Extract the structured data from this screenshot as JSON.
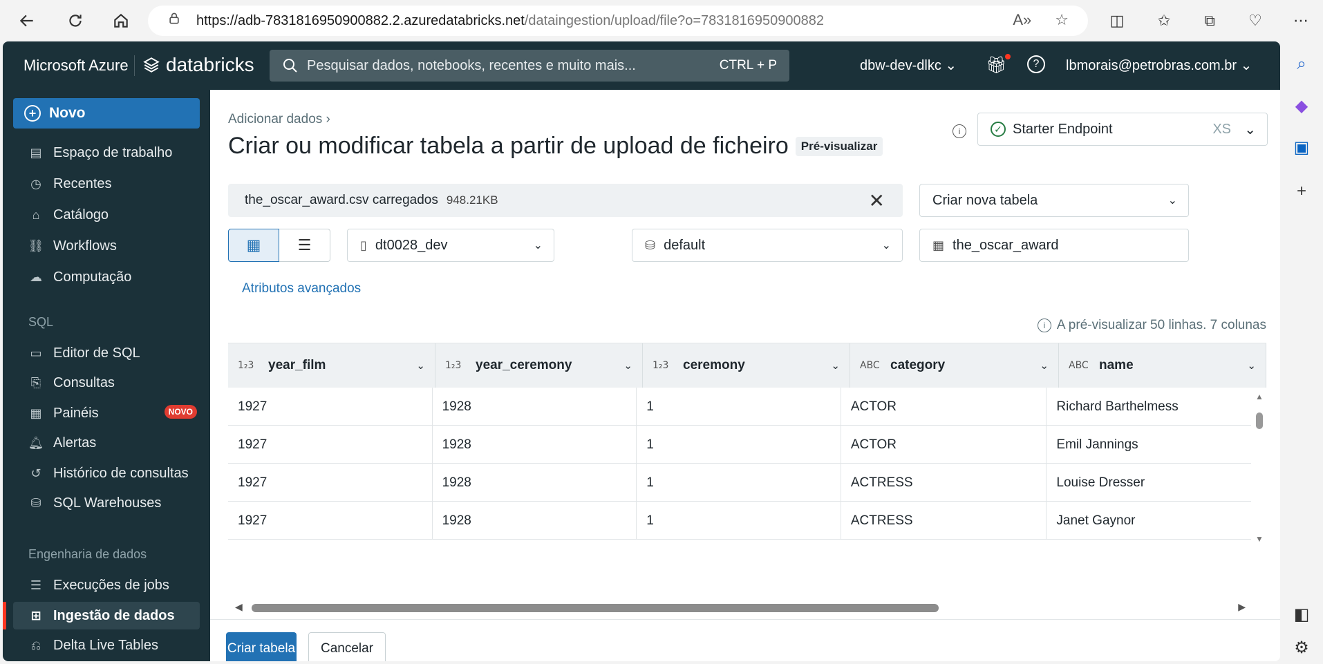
{
  "browser": {
    "url_host": "https://adb-7831816950900882.2.azuredatabricks.net",
    "url_path": "/dataingestion/upload/file?o=7831816950900882"
  },
  "topbar": {
    "ms_azure": "Microsoft Azure",
    "databricks": "databricks",
    "search_placeholder": "Pesquisar dados, notebooks, recentes e muito mais...",
    "search_shortcut": "CTRL + P",
    "workspace": "dbw-dev-dlkc",
    "user": "lbmorais@petrobras.com.br"
  },
  "sidebar": {
    "new_label": "Novo",
    "items": [
      {
        "label": "Espaço de trabalho",
        "icon": "workspace-icon"
      },
      {
        "label": "Recentes",
        "icon": "clock-icon"
      },
      {
        "label": "Catálogo",
        "icon": "catalog-icon"
      },
      {
        "label": "Workflows",
        "icon": "workflows-icon"
      },
      {
        "label": "Computação",
        "icon": "cloud-icon"
      }
    ],
    "sql_label": "SQL",
    "sql_items": [
      {
        "label": "Editor de SQL",
        "icon": "sql-editor-icon"
      },
      {
        "label": "Consultas",
        "icon": "queries-icon"
      },
      {
        "label": "Painéis",
        "icon": "dashboards-icon"
      },
      {
        "label": "Alertas",
        "icon": "bell-icon"
      },
      {
        "label": "Histórico de consultas",
        "icon": "history-icon"
      },
      {
        "label": "SQL Warehouses",
        "icon": "warehouse-icon"
      }
    ],
    "badge_novo": "NOVO",
    "eng_label": "Engenharia de dados",
    "eng_items": [
      {
        "label": "Execuções de jobs",
        "icon": "job-runs-icon"
      },
      {
        "label": "Ingestão de dados",
        "icon": "ingestion-icon"
      },
      {
        "label": "Delta Live Tables",
        "icon": "dlt-icon"
      }
    ]
  },
  "main": {
    "breadcrumb": "Adicionar dados",
    "title": "Criar ou modificar tabela a partir de upload de ficheiro",
    "preview_tag": "Pré-visualizar",
    "endpoint_name": "Starter Endpoint",
    "endpoint_size": "XS",
    "file_name": "the_oscar_award.csv carregados",
    "file_size": "948.21KB",
    "create_mode": "Criar nova tabela",
    "catalog": "dt0028_dev",
    "schema": "default",
    "table_name": "the_oscar_award",
    "advanced_link": "Atributos avançados",
    "preview_info": "A pré-visualizar 50 linhas. 7 colunas"
  },
  "table": {
    "columns": [
      {
        "name": "year_film",
        "type": "1₂3"
      },
      {
        "name": "year_ceremony",
        "type": "1₂3"
      },
      {
        "name": "ceremony",
        "type": "1₂3"
      },
      {
        "name": "category",
        "type": "ABC"
      },
      {
        "name": "name",
        "type": "ABC"
      }
    ],
    "rows": [
      [
        "1927",
        "1928",
        "1",
        "ACTOR",
        "Richard Barthelmess"
      ],
      [
        "1927",
        "1928",
        "1",
        "ACTOR",
        "Emil Jannings"
      ],
      [
        "1927",
        "1928",
        "1",
        "ACTRESS",
        "Louise Dresser"
      ],
      [
        "1927",
        "1928",
        "1",
        "ACTRESS",
        "Janet Gaynor"
      ]
    ]
  },
  "footer": {
    "create_label": "Criar tabela",
    "cancel_label": "Cancelar"
  }
}
